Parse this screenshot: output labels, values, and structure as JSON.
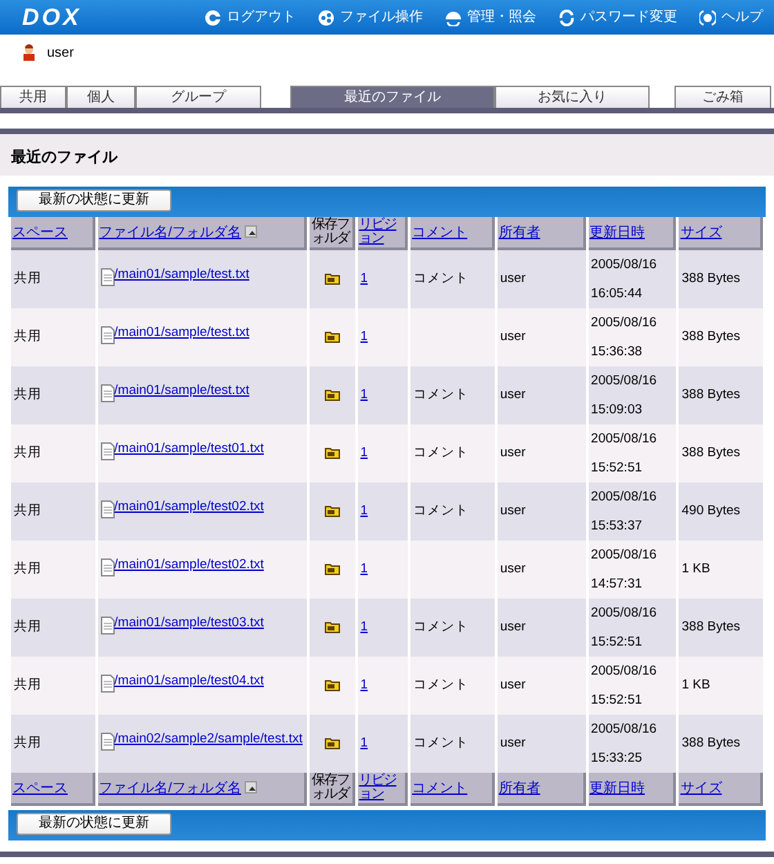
{
  "logo": "DOX",
  "nav": [
    "ログアウト",
    "ファイル操作",
    "管理・照会",
    "パスワード変更",
    "ヘルプ"
  ],
  "user": "user",
  "tabs": [
    {
      "label": "共用",
      "selected": false
    },
    {
      "label": "個人",
      "selected": false
    },
    {
      "label": "グループ",
      "selected": false
    },
    {
      "label": "最近のファイル",
      "selected": true
    },
    {
      "label": "お気に入り",
      "selected": false
    },
    {
      "label": "ごみ箱",
      "selected": false
    }
  ],
  "page_title": "最近のファイル",
  "refresh_button_top": "最新の状態に更新",
  "columns": [
    "スペース",
    "ファイル名/フォルダ名",
    "保存フォルダ",
    "リビジョン",
    "コメント",
    "所有者",
    "更新日時",
    "サイズ"
  ],
  "rows": [
    {
      "space": "共用",
      "file": "/main01/sample/test.txt",
      "revision": "1",
      "comment": "コメント",
      "owner": "user",
      "date": "2005/08/16",
      "time": "16:05:44",
      "size": "388 Bytes"
    },
    {
      "space": "共用",
      "file": "/main01/sample/test.txt",
      "revision": "1",
      "owner": "user",
      "date": "2005/08/16",
      "time": "15:36:38",
      "size": "388 Bytes"
    },
    {
      "space": "共用",
      "file": "/main01/sample/test.txt",
      "revision": "1",
      "comment": "コメント",
      "owner": "user",
      "date": "2005/08/16",
      "time": "15:09:03",
      "size": "388 Bytes"
    },
    {
      "space": "共用",
      "file": "/main01/sample/test01.txt",
      "revision": "1",
      "comment": "コメント",
      "owner": "user",
      "date": "2005/08/16",
      "time": "15:52:51",
      "size": "388 Bytes"
    },
    {
      "space": "共用",
      "file": "/main01/sample/test02.txt",
      "revision": "1",
      "comment": "コメント",
      "owner": "user",
      "date": "2005/08/16",
      "time": "15:53:37",
      "size": "490 Bytes"
    },
    {
      "space": "共用",
      "file": "/main01/sample/test02.txt",
      "revision": "1",
      "owner": "user",
      "date": "2005/08/16",
      "time": "14:57:31",
      "size": "1 KB"
    },
    {
      "space": "共用",
      "file": "/main01/sample/test03.txt",
      "revision": "1",
      "comment": "コメント",
      "owner": "user",
      "date": "2005/08/16",
      "time": "15:52:51",
      "size": "388 Bytes"
    },
    {
      "space": "共用",
      "file": "/main01/sample/test04.txt",
      "revision": "1",
      "comment": "コメント",
      "owner": "user",
      "date": "2005/08/16",
      "time": "15:52:51",
      "size": "1 KB"
    },
    {
      "space": "共用",
      "file": "/main02/sample2/sample/test.txt",
      "revision": "1",
      "comment": "コメント",
      "owner": "user",
      "date": "2005/08/16",
      "time": "15:33:25",
      "size": "388 Bytes"
    }
  ],
  "footer_columns": [
    "スペース",
    "ファイル名/フォルダ名",
    "保存フォルダ",
    "リビジョン",
    "コメント",
    "所有者",
    "更新日時",
    "サイズ"
  ],
  "refresh_button_bottom": "最新の状態に更新"
}
